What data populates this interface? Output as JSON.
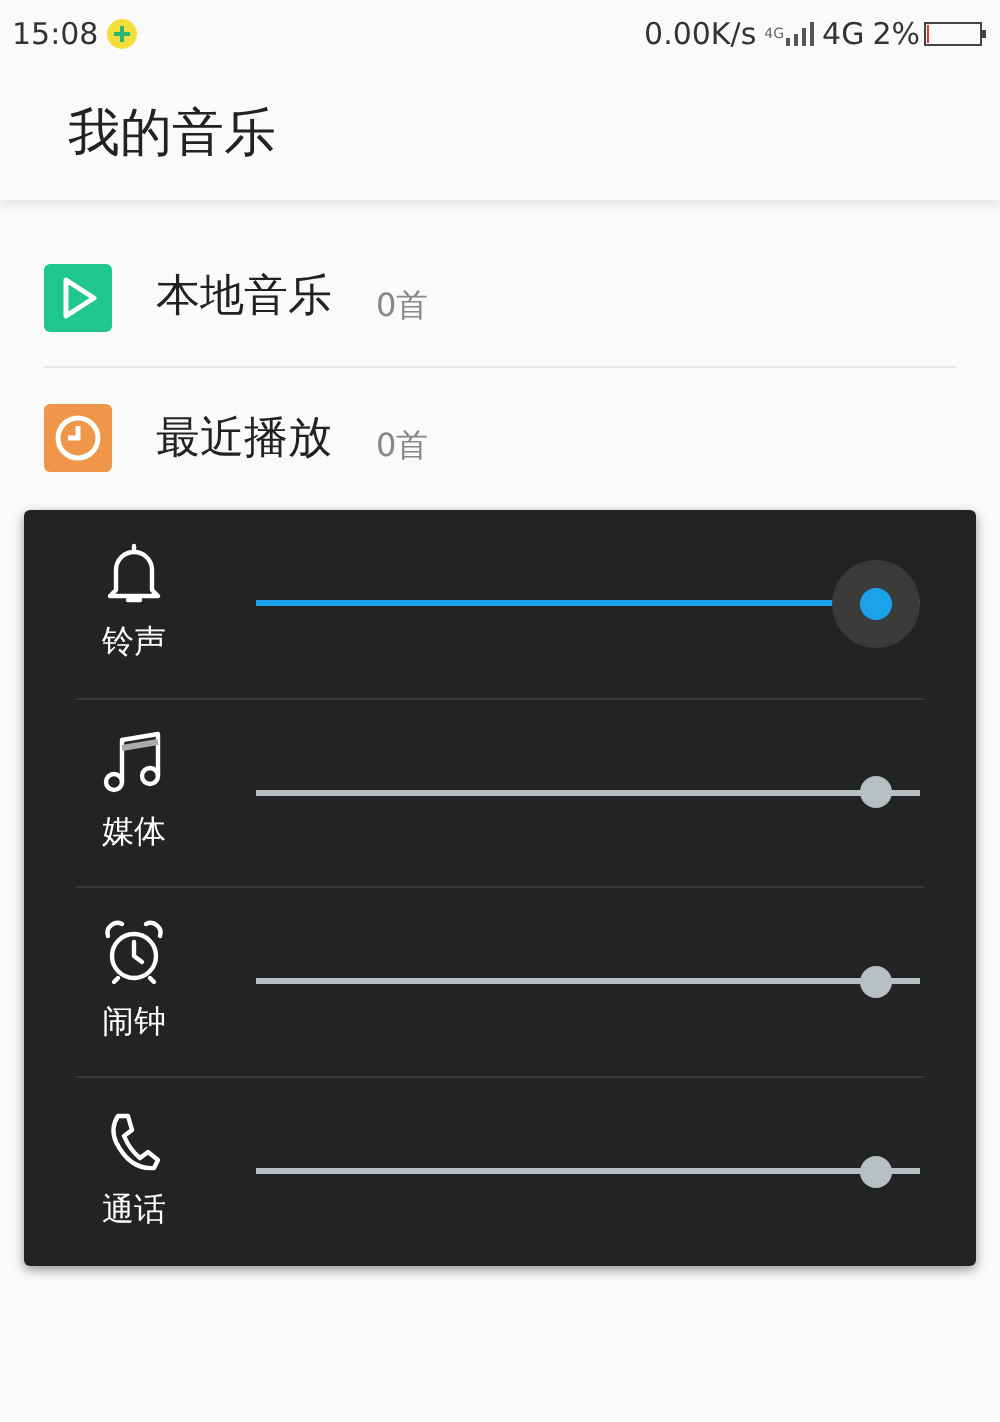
{
  "status_bar": {
    "time": "15:08",
    "speed": "0.00K/s",
    "network_small": "4G",
    "network": "4G",
    "battery": "2%"
  },
  "title": "我的音乐",
  "items": [
    {
      "kind": "play",
      "label": "本地音乐",
      "count": "0首"
    },
    {
      "kind": "recent",
      "label": "最近播放",
      "count": "0首"
    }
  ],
  "volume_panel": {
    "channels": [
      {
        "kind": "bell",
        "name": "铃声",
        "level": 1,
        "selected": true
      },
      {
        "kind": "note",
        "name": "媒体",
        "level": 1,
        "selected": false
      },
      {
        "kind": "alarm",
        "name": "闹钟",
        "level": 1,
        "selected": false
      },
      {
        "kind": "phone",
        "name": "通话",
        "level": 1,
        "selected": false
      }
    ]
  }
}
